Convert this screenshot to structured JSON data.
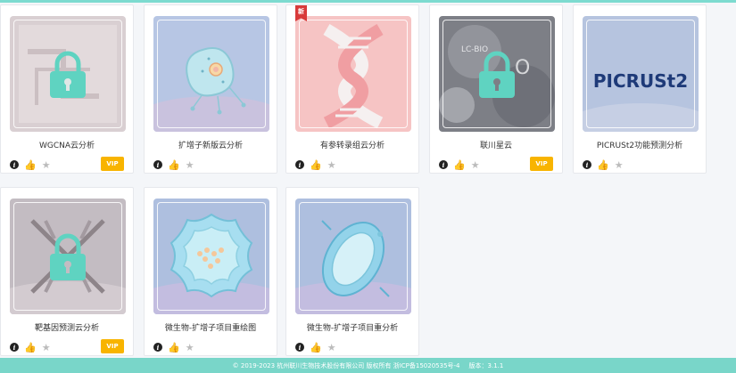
{
  "cards": [
    {
      "title": "WGCNA云分析",
      "vip_label": "VIP",
      "locked": true
    },
    {
      "title": "扩增子新版云分析"
    },
    {
      "title": "有参转录组云分析",
      "new_badge": "新"
    },
    {
      "title": "联川星云",
      "vip_label": "VIP",
      "locked": true,
      "cover_text": "LC-BIO"
    },
    {
      "title": "PICRUSt2功能预测分析",
      "cover_text": "PICRUSt2"
    },
    {
      "title": "靶基因预测云分析",
      "vip_label": "VIP",
      "locked": true
    },
    {
      "title": "微生物-扩增子项目重绘图"
    },
    {
      "title": "微生物-扩增子项目重分析"
    }
  ],
  "footer": {
    "copyright": "© 2019-2023 杭州联川生物技术股份有限公司 版权所有 浙ICP备15020535号-4",
    "version": "版本：3.1.1"
  },
  "colors": {
    "accent": "#79d6c9",
    "vip": "#f8b400",
    "new": "#d83a3a",
    "lock": "#5fd3c1"
  }
}
